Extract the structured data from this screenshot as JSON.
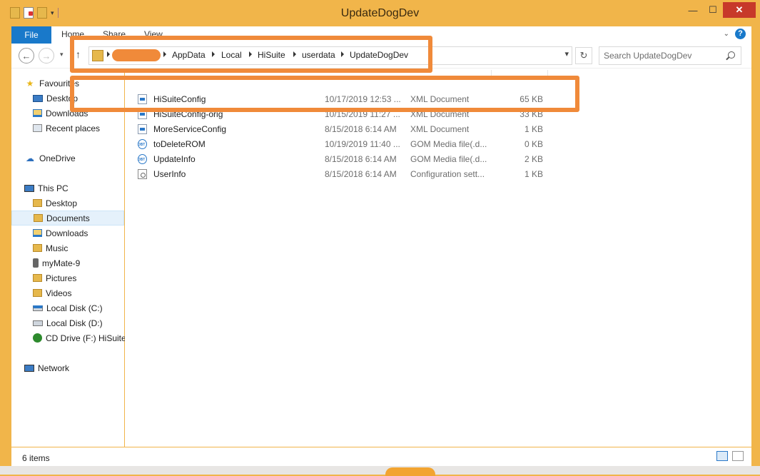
{
  "window": {
    "title": "UpdateDogDev",
    "colors": {
      "frame": "#f1b54a",
      "accent": "#1979ca",
      "close": "#c7392a",
      "highlight": "#f08a3a"
    }
  },
  "ribbon": {
    "file_tab": "File",
    "tabs": [
      "Home",
      "Share",
      "View"
    ]
  },
  "address": {
    "crumbs": [
      "AppData",
      "Local",
      "HiSuite",
      "userdata",
      "UpdateDogDev"
    ]
  },
  "search": {
    "placeholder": "Search UpdateDogDev"
  },
  "nav": {
    "favourites": {
      "label": "Favourites",
      "items": [
        "Desktop",
        "Downloads",
        "Recent places"
      ]
    },
    "onedrive": "OneDrive",
    "thispc": {
      "label": "This PC",
      "items": [
        "Desktop",
        "Documents",
        "Downloads",
        "Music",
        "myMate-9",
        "Pictures",
        "Videos",
        "Local Disk (C:)",
        "Local Disk (D:)",
        "CD Drive (F:) HiSuite"
      ]
    },
    "network": "Network",
    "selected": "Documents"
  },
  "files": [
    {
      "name": "HiSuiteConfig",
      "date": "10/17/2019 12:53 ...",
      "type": "XML Document",
      "size": "65 KB",
      "icon": "xml-file-icon"
    },
    {
      "name": "HiSuiteConfig-orig",
      "date": "10/15/2019 11:27 ...",
      "type": "XML Document",
      "size": "33 KB",
      "icon": "xml-file-icon"
    },
    {
      "name": "MoreServiceConfig",
      "date": "8/15/2018 6:14 AM",
      "type": "XML Document",
      "size": "1 KB",
      "icon": "xml-file-icon"
    },
    {
      "name": "toDeleteROM",
      "date": "10/19/2019 11:40 ...",
      "type": "GOM Media file(.d...",
      "size": "0 KB",
      "icon": "dbt-file-icon"
    },
    {
      "name": "UpdateInfo",
      "date": "8/15/2018 6:14 AM",
      "type": "GOM Media file(.d...",
      "size": "2 KB",
      "icon": "dbt-file-icon"
    },
    {
      "name": "UserInfo",
      "date": "8/15/2018 6:14 AM",
      "type": "Configuration sett...",
      "size": "1 KB",
      "icon": "config-file-icon"
    }
  ],
  "status": {
    "count": "6 items"
  }
}
